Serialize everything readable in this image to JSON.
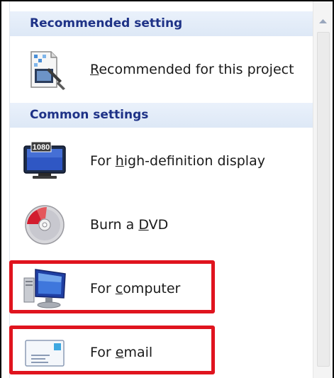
{
  "sections": {
    "recommended": {
      "header": "Recommended setting"
    },
    "common": {
      "header": "Common settings"
    }
  },
  "items": [
    {
      "pre": "",
      "key": "R",
      "post": "ecommended for this project",
      "icon": "recommended-project-icon"
    },
    {
      "pre": "For ",
      "key": "h",
      "post": "igh-definition display",
      "icon": "hd-display-icon",
      "badge": "1080"
    },
    {
      "pre": "Burn a ",
      "key": "D",
      "post": "VD",
      "icon": "dvd-disc-icon"
    },
    {
      "pre": "For ",
      "key": "c",
      "post": "omputer",
      "icon": "computer-icon"
    },
    {
      "pre": "For ",
      "key": "e",
      "post": "mail",
      "icon": "email-icon"
    }
  ],
  "annotation": {
    "color": "#e0141e",
    "highlighted": [
      "For computer",
      "For email"
    ]
  }
}
